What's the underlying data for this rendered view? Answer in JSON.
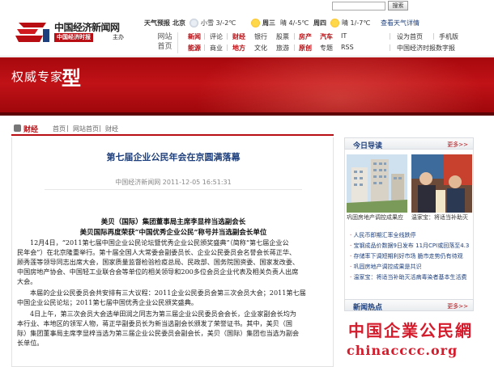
{
  "search": {
    "value": "",
    "button": "搜索"
  },
  "logo": {
    "title": "中国经济新闻网",
    "tag": "中国经济时报",
    "tag_suffix": "主办"
  },
  "weather": {
    "label": "天气预报",
    "city": "北京",
    "d1": "小雪 3/-2℃",
    "d2_day": "周三",
    "d2": "晴 4/-5℃",
    "d3_day": "周四",
    "d3": "晴 1/-7℃",
    "more": "查看天气详情"
  },
  "site_nav": {
    "label1": "网站",
    "label2": "首页"
  },
  "nav": {
    "row1": [
      "新闻",
      "评论",
      "财经",
      "银行",
      "股票",
      "房产",
      "汽车",
      "IT",
      "设为首页",
      "手机版"
    ],
    "row2": [
      "能源",
      "商业",
      "地方",
      "文化",
      "旅游",
      "原创",
      "专题",
      "RSS",
      "中国经济时报数字报"
    ]
  },
  "banner": {
    "prefix": "权威专家",
    "big": "型"
  },
  "breadcrumb": {
    "channel": "财经",
    "home": "首页",
    "site": "网站首页",
    "section": "财经"
  },
  "article": {
    "title": "第七届企业公民年会在京圆满落幕",
    "meta": "中国经济新闻网 2011-12-05 16:51:31",
    "sub1": "美贝（国际）集团董事局主席李显梓当选副会长",
    "sub2": "美贝国际再度荣获“中国优秀企业公民”称号并当选副会长单位",
    "p1": [
      "12月4日，“2011第七届中国企业公民论坛暨优秀企业公民颁奖盛典”（简称“第七届企业公",
      "民年会”）在北京隆重举行。第十届全国人大常委会副委员长、企业公民委员会名誉会长蒋正华、",
      "顾秀莲等领导同志出席大会，国家质量监督检验检疫总局、民政部、国务院国资委、国家发改委、",
      "中国房地产协会、中国轻工业联合会等单位的相关领导和200多位会员企业代表及相关负责人出席",
      "大会。"
    ],
    "p2": [
      "本届的企业公民委员会共安排有三大议程：2011企业公民委员会第三次会员大会；2011第七届",
      "中国企业公民论坛；2011第七届中国优秀企业公民颁奖盛典。"
    ],
    "p3": [
      "4日上午，第三次会员大会选举田润之同志为第三届企业公民委员会会长，企业家副会长均为",
      "本行业、本地区的领军人物，蒋正华副委员长为新当选副会长颁发了荣誉证书。其中，美贝（国",
      "际）集团董事局主席李显梓当选为第三届企业公民委员会副会长，美贝（国际）集团也当选为副会",
      "长单位。"
    ]
  },
  "today": {
    "title": "今日导读",
    "more": "更多>>",
    "captions": [
      "巩固房地产调控成果应",
      "温家宝：将适当补助灭"
    ],
    "list": [
      "人民币即期汇率全线跌停",
      "宝钢成品价数据9日发布 11月CPI或回落至4.3",
      "存储率下调短期利好市场 脆市走势仍有待观",
      "巩固房地产调控成果是共识",
      "温家宝：将适当补助灭活病毒染者基本生活费"
    ]
  },
  "hot": {
    "title": "新闻热点",
    "more": "更多>>"
  },
  "watermark": {
    "cn": "中国企業公民網",
    "url": "chinacccc.org"
  }
}
